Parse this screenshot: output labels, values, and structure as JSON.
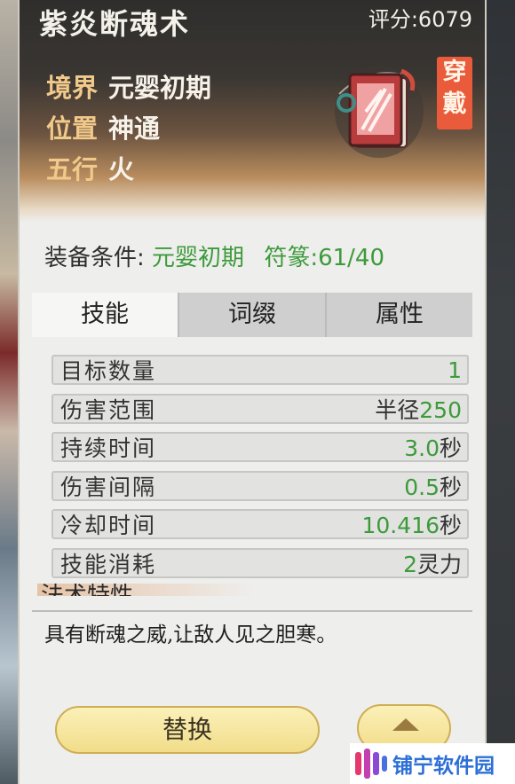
{
  "item": {
    "title": "紫炎断魂术",
    "score_label": "评分:",
    "score_value": "6079",
    "wear_tag": "穿戴"
  },
  "info": [
    {
      "key": "境界",
      "value": "元婴初期"
    },
    {
      "key": "位置",
      "value": "神通"
    },
    {
      "key": "五行",
      "value": "火"
    }
  ],
  "requirements": {
    "label": "装备条件:",
    "realm": "元婴初期",
    "talisman": "符篆:61/40"
  },
  "tabs": [
    {
      "label": "技能",
      "active": true
    },
    {
      "label": "词缀",
      "active": false
    },
    {
      "label": "属性",
      "active": false
    }
  ],
  "stats": [
    {
      "key": "目标数量",
      "prefix": "",
      "num": "1",
      "suffix": ""
    },
    {
      "key": "伤害范围",
      "prefix": "半径",
      "num": "250",
      "suffix": ""
    },
    {
      "key": "持续时间",
      "prefix": "",
      "num": "3.0",
      "suffix": "秒"
    },
    {
      "key": "伤害间隔",
      "prefix": "",
      "num": "0.5",
      "suffix": "秒"
    },
    {
      "key": "冷却时间",
      "prefix": "",
      "num": "10.416",
      "suffix": "秒"
    },
    {
      "key": "技能消耗",
      "prefix": "",
      "num": "2",
      "suffix": "灵力"
    }
  ],
  "section_header": "法术特性",
  "description": "具有断魂之威,让敌人见之胆寒。",
  "buttons": {
    "swap_label": "替换",
    "collapse_icon": "chevron-up-icon"
  },
  "watermark": {
    "text": "铺宁软件园",
    "brand_color": "#2c6fd6"
  },
  "colors": {
    "green": "#3d9a3b",
    "gold": "#f1c98a",
    "tag_red": "#e95b3a"
  }
}
